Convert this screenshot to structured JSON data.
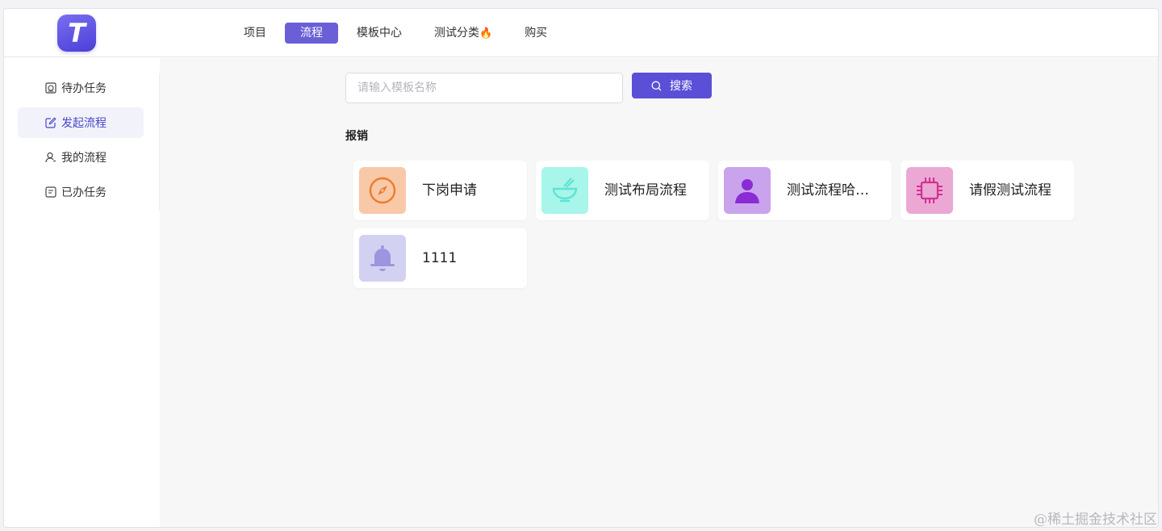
{
  "app": {
    "logo_letter": "T"
  },
  "nav": {
    "items": [
      {
        "label": "项目",
        "active": false
      },
      {
        "label": "流程",
        "active": true
      },
      {
        "label": "模板中心",
        "active": false
      },
      {
        "label": "测试分类",
        "active": false,
        "badge_icon": "fire-icon"
      },
      {
        "label": "购买",
        "active": false
      }
    ]
  },
  "sidebar": {
    "items": [
      {
        "label": "待办任务",
        "icon": "todo-icon",
        "active": false
      },
      {
        "label": "发起流程",
        "icon": "edit-icon",
        "active": true
      },
      {
        "label": "我的流程",
        "icon": "user-icon",
        "active": false
      },
      {
        "label": "已办任务",
        "icon": "done-list-icon",
        "active": false
      }
    ]
  },
  "search": {
    "placeholder": "请输入模板名称",
    "value": "",
    "button_label": "搜索"
  },
  "section": {
    "title": "报销"
  },
  "cards": [
    {
      "label": "下岗申请",
      "icon": "compass-icon",
      "bg": "#f8c9a8",
      "fg": "#f07a2a"
    },
    {
      "label": "测试布局流程",
      "icon": "bowl-icon",
      "bg": "#a8f5ea",
      "fg": "#5ee3d2"
    },
    {
      "label": "测试流程哈…",
      "icon": "person-icon",
      "bg": "#c9a3ec",
      "fg": "#8a2bd6"
    },
    {
      "label": "请假测试流程",
      "icon": "chip-icon",
      "bg": "#eba8d5",
      "fg": "#d2308f"
    },
    {
      "label": "1111",
      "icon": "bell-icon",
      "bg": "#d3d1f2",
      "fg": "#9d95e0"
    }
  ],
  "colors": {
    "accent": "#5b4fd8",
    "nav_active": "#6a5fd6"
  },
  "watermark": "@稀土掘金技术社区"
}
